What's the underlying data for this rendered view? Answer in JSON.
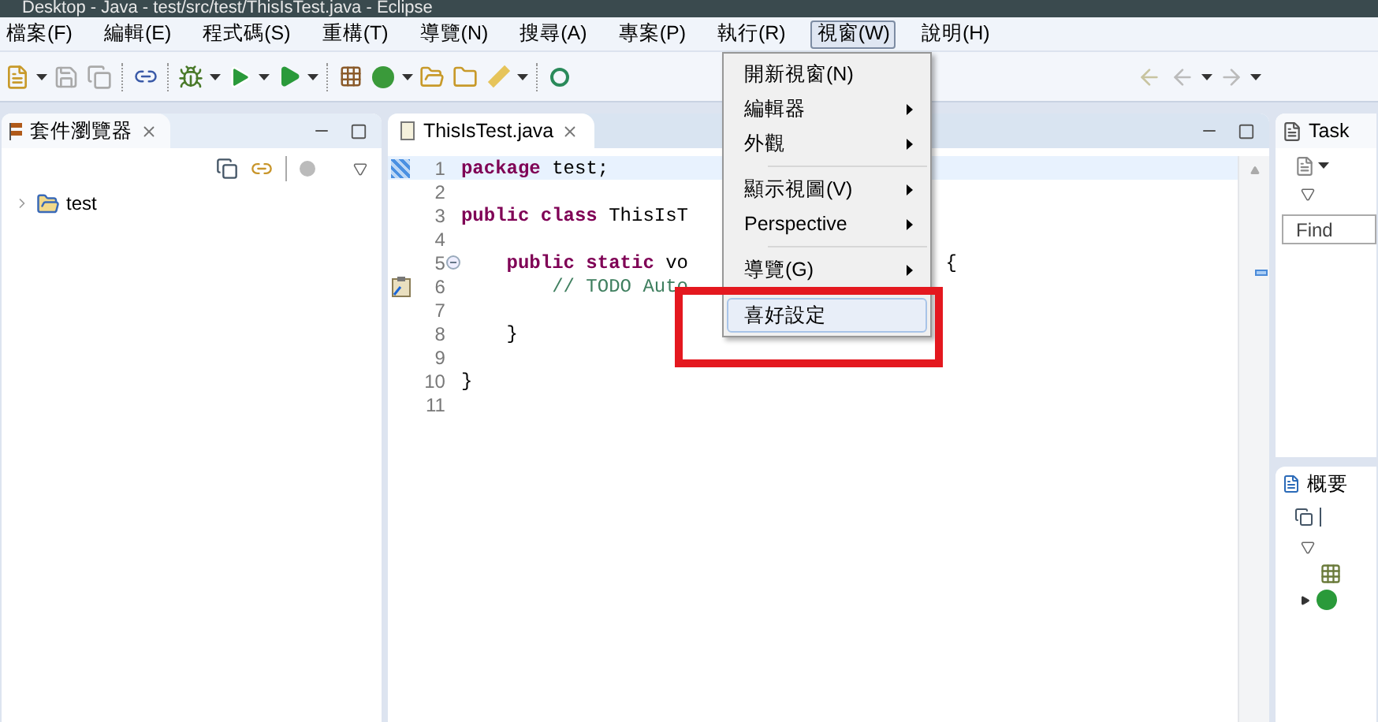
{
  "window": {
    "title": "Desktop - Java - test/src/test/ThisIsTest.java - Eclipse"
  },
  "menu_bar": [
    {
      "label": "檔案(F)",
      "selected": false
    },
    {
      "label": "編輯(E)",
      "selected": false
    },
    {
      "label": "程式碼(S)",
      "selected": false
    },
    {
      "label": "重構(T)",
      "selected": false
    },
    {
      "label": "導覽(N)",
      "selected": false
    },
    {
      "label": "搜尋(A)",
      "selected": false
    },
    {
      "label": "專案(P)",
      "selected": false
    },
    {
      "label": "執行(R)",
      "selected": false
    },
    {
      "label": "視窗(W)",
      "selected": true
    },
    {
      "label": "說明(H)",
      "selected": false
    }
  ],
  "window_menu": [
    {
      "kind": "item",
      "label": "開新視窗(N)",
      "submenu": false,
      "selected": false
    },
    {
      "kind": "item",
      "label": "編輯器",
      "submenu": true,
      "selected": false
    },
    {
      "kind": "item",
      "label": "外觀",
      "submenu": true,
      "selected": false
    },
    {
      "kind": "separator"
    },
    {
      "kind": "item",
      "label": "顯示視圖(V)",
      "submenu": true,
      "selected": false
    },
    {
      "kind": "item",
      "label": "Perspective",
      "submenu": true,
      "selected": false
    },
    {
      "kind": "separator"
    },
    {
      "kind": "item",
      "label": "導覽(G)",
      "submenu": true,
      "selected": false
    },
    {
      "kind": "separator"
    },
    {
      "kind": "item",
      "label": "喜好設定",
      "submenu": false,
      "selected": true
    }
  ],
  "package_explorer": {
    "tab": "套件瀏覽器",
    "tree": [
      {
        "label": "test",
        "expanded": false
      }
    ]
  },
  "editor": {
    "tab": "ThisIsTest.java",
    "lines": [
      {
        "number": "1",
        "quick_diff": true,
        "task": false,
        "fold": false,
        "tokens": [
          {
            "kind": "keyword",
            "text": "package"
          },
          {
            "kind": "plain",
            "text": " test;"
          }
        ]
      },
      {
        "number": "2",
        "quick_diff": false,
        "task": false,
        "fold": false
      },
      {
        "number": "3",
        "quick_diff": false,
        "task": false,
        "fold": false,
        "tokens": [
          {
            "kind": "keyword",
            "text": "public class"
          },
          {
            "kind": "plain",
            "text": " ThisIsT"
          }
        ]
      },
      {
        "number": "4",
        "quick_diff": false,
        "task": false,
        "fold": false
      },
      {
        "number": "5",
        "quick_diff": false,
        "task": false,
        "fold": true,
        "tokens": [
          {
            "kind": "keyword",
            "text": "    public static"
          },
          {
            "kind": "plain",
            "text": " vo"
          }
        ],
        "tail": "{"
      },
      {
        "number": "6",
        "quick_diff": false,
        "task": true,
        "fold": false,
        "tokens": [
          {
            "kind": "comment",
            "text": "        // TODO Auto"
          }
        ]
      },
      {
        "number": "7",
        "quick_diff": false,
        "task": false,
        "fold": false
      },
      {
        "number": "8",
        "quick_diff": false,
        "task": false,
        "fold": false,
        "tokens": [
          {
            "kind": "plain",
            "text": "    }"
          }
        ]
      },
      {
        "number": "9",
        "quick_diff": false,
        "task": false,
        "fold": false
      },
      {
        "number": "10",
        "quick_diff": false,
        "task": false,
        "fold": false,
        "tokens": [
          {
            "kind": "plain",
            "text": "}"
          }
        ]
      },
      {
        "number": "11",
        "quick_diff": false,
        "task": false,
        "fold": false
      }
    ]
  },
  "task_list": {
    "tab": "Task",
    "find": {
      "placeholder": "Find"
    }
  },
  "outline": {
    "tab": "概要"
  }
}
